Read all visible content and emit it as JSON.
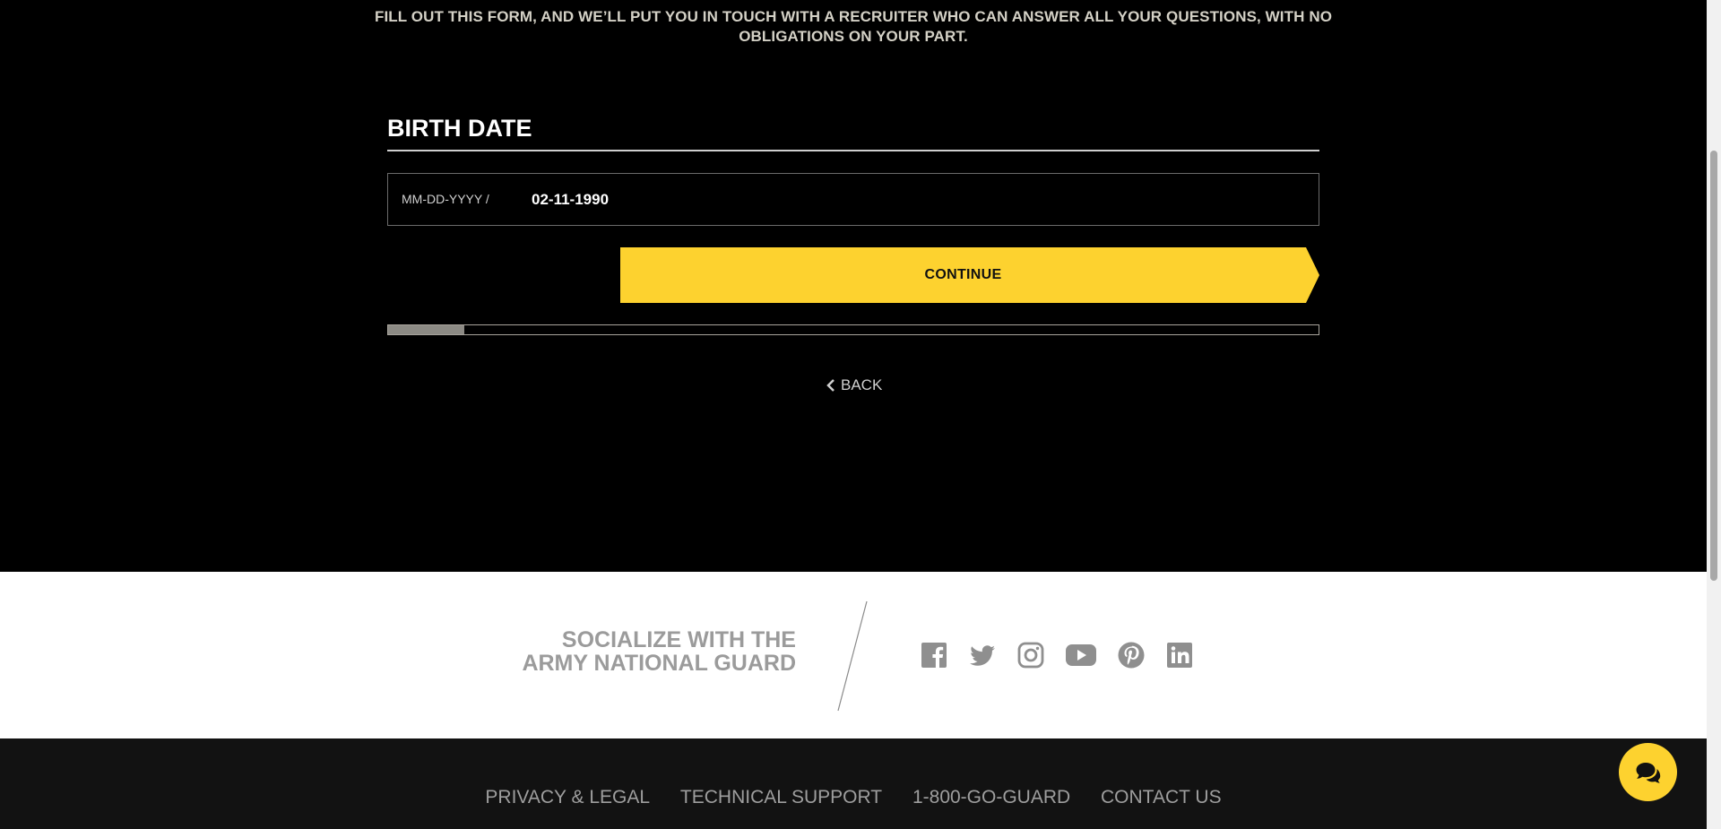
{
  "intro": {
    "text": "FILL OUT THIS FORM, AND WE’LL PUT YOU IN TOUCH WITH A RECRUITER WHO CAN ANSWER ALL YOUR QUESTIONS, WITH NO OBLIGATIONS ON YOUR PART."
  },
  "form": {
    "label": "BIRTH DATE",
    "date_hint": "MM-DD-YYYY /",
    "date_value": "02-11-1990",
    "continue_label": "CONTINUE",
    "progress_fraction": 0.082,
    "back_label": "BACK"
  },
  "social": {
    "title_line1": "SOCIALIZE WITH THE",
    "title_line2": "ARMY NATIONAL GUARD",
    "icons": [
      "facebook-icon",
      "twitter-icon",
      "instagram-icon",
      "youtube-icon",
      "pinterest-icon",
      "linkedin-icon"
    ]
  },
  "footer": {
    "links": [
      "PRIVACY & LEGAL",
      "TECHNICAL SUPPORT",
      "1-800-GO-GUARD",
      "CONTACT US"
    ]
  },
  "colors": {
    "accent_yellow": "#fdd22f",
    "social_gray": "#9b9b9b",
    "footer_bg": "#121212"
  }
}
